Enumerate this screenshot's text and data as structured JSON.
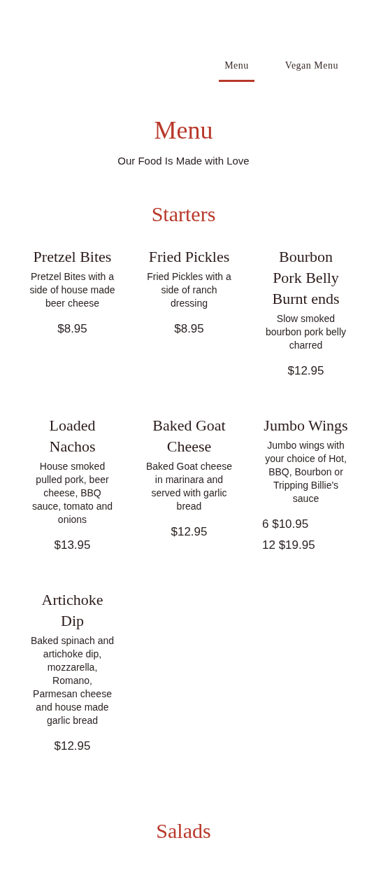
{
  "tabs": [
    {
      "label": "Menu",
      "selected": true
    },
    {
      "label": "Vegan Menu",
      "selected": false
    }
  ],
  "title": "Menu",
  "subtitle": "Our Food Is Made with Love",
  "sections": [
    {
      "heading": "Starters",
      "items": [
        {
          "name": "Pretzel Bites",
          "description": "Pretzel Bites with a side of house made beer cheese",
          "prices": [
            "$8.95"
          ]
        },
        {
          "name": "Fried Pickles",
          "description": "Fried Pickles with a side of ranch dressing",
          "prices": [
            "$8.95"
          ]
        },
        {
          "name": "Bourbon Pork Belly Burnt ends",
          "description": "Slow smoked bourbon pork belly charred",
          "prices": [
            "$12.95"
          ]
        },
        {
          "name": "Loaded Nachos",
          "description": "House smoked pulled pork, beer cheese, BBQ sauce, tomato and onions",
          "prices": [
            "$13.95"
          ]
        },
        {
          "name": "Baked Goat Cheese",
          "description": "Baked Goat cheese in marinara and served with garlic bread",
          "prices": [
            "$12.95"
          ]
        },
        {
          "name": "Jumbo Wings",
          "description": "Jumbo wings with your choice of Hot, BBQ, Bourbon or Tripping Billie's sauce",
          "prices": [
            "6 $10.95",
            "12 $19.95"
          ]
        },
        {
          "name": "Artichoke Dip",
          "description": "Baked spinach and artichoke dip, mozzarella, Romano, Parmesan cheese and house made garlic bread",
          "prices": [
            "$12.95"
          ]
        }
      ]
    },
    {
      "heading": "Salads"
    }
  ]
}
